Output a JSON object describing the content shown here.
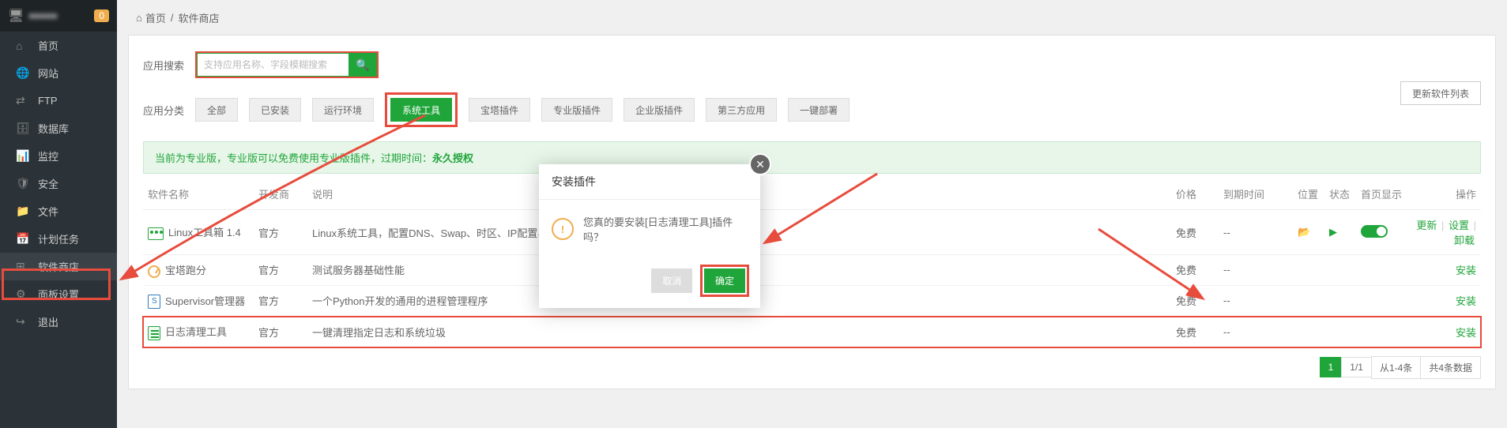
{
  "sidebar": {
    "badge": "0",
    "items": [
      {
        "label": "首页",
        "icon": "home"
      },
      {
        "label": "网站",
        "icon": "globe"
      },
      {
        "label": "FTP",
        "icon": "ftp"
      },
      {
        "label": "数据库",
        "icon": "database"
      },
      {
        "label": "监控",
        "icon": "monitor"
      },
      {
        "label": "安全",
        "icon": "shield"
      },
      {
        "label": "文件",
        "icon": "folder"
      },
      {
        "label": "计划任务",
        "icon": "calendar"
      },
      {
        "label": "软件商店",
        "icon": "grid"
      },
      {
        "label": "面板设置",
        "icon": "gear"
      },
      {
        "label": "退出",
        "icon": "exit"
      }
    ]
  },
  "breadcrumb": {
    "home": "首页",
    "current": "软件商店"
  },
  "search": {
    "label": "应用搜索",
    "placeholder": "支持应用名称、字段模糊搜索"
  },
  "categories": {
    "label": "应用分类",
    "items": [
      "全部",
      "已安装",
      "运行环境",
      "系统工具",
      "宝塔插件",
      "专业版插件",
      "企业版插件",
      "第三方应用",
      "一键部署"
    ],
    "active": "系统工具"
  },
  "update_btn": "更新软件列表",
  "notice": {
    "prefix": "当前为专业版，专业版可以免费使用专业版插件，过期时间：",
    "bold": "永久授权"
  },
  "table": {
    "headers": {
      "name": "软件名称",
      "dev": "开发商",
      "desc": "说明",
      "price": "价格",
      "expire": "到期时间",
      "pos": "位置",
      "status": "状态",
      "home": "首页显示",
      "op": "操作"
    },
    "rows": [
      {
        "name": "Linux工具箱 1.4",
        "dev": "官方",
        "desc": "Linux系统工具，配置DNS、Swap、时区、IP配置、内存盘！",
        "price": "免费",
        "expire": "--",
        "installed": true
      },
      {
        "name": "宝塔跑分",
        "dev": "官方",
        "desc": "测试服务器基础性能",
        "price": "免费",
        "expire": "--",
        "installed": false
      },
      {
        "name": "Supervisor管理器",
        "dev": "官方",
        "desc": "一个Python开发的通用的进程管理程序",
        "price": "免费",
        "expire": "--",
        "installed": false
      },
      {
        "name": "日志清理工具",
        "dev": "官方",
        "desc": "一键清理指定日志和系统垃圾",
        "price": "免费",
        "expire": "--",
        "installed": false
      }
    ],
    "actions": {
      "update": "更新",
      "setting": "设置",
      "uninstall": "卸载",
      "install": "安装"
    }
  },
  "pager": {
    "current": "1",
    "pages": "1/1",
    "range": "从1-4条",
    "total": "共4条数据"
  },
  "modal": {
    "title": "安装插件",
    "message": "您真的要安装[日志清理工具]插件吗？",
    "cancel": "取消",
    "ok": "确定"
  }
}
